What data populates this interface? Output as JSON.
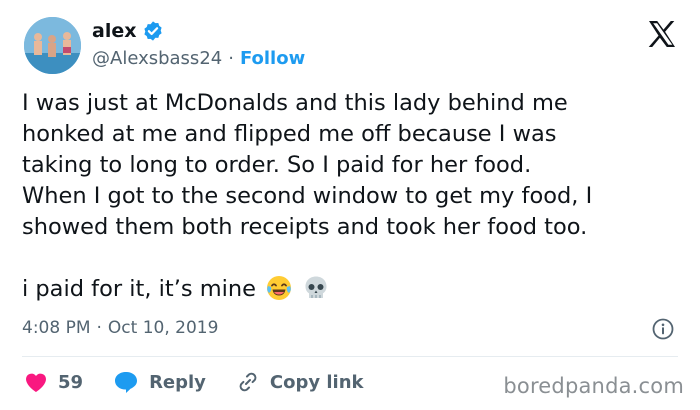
{
  "author": {
    "display_name": "alex",
    "handle": "@Alexsbass24",
    "separator": "·",
    "follow_label": "Follow",
    "avatar_icon": "avatar-photo",
    "verified_icon": "verified-badge-icon"
  },
  "tweet": {
    "lines": [
      "I was just at McDonalds and this lady behind me",
      "honked at me and flipped me off because I was",
      "taking to long to order. So I paid for her food.",
      "When I got to the second window to get my food, I",
      "showed them both receipts and took her food too."
    ],
    "closing": "i paid for it, it’s mine"
  },
  "meta": {
    "time": "4:08 PM",
    "separator": "·",
    "date": "Oct 10, 2019"
  },
  "actions": {
    "like_count": "59",
    "reply_label": "Reply",
    "copy_link_label": "Copy link"
  },
  "watermark": "boredpanda.com",
  "colors": {
    "link_blue": "#1d9bf0",
    "heart_red": "#f91880",
    "text_gray": "#536471"
  }
}
